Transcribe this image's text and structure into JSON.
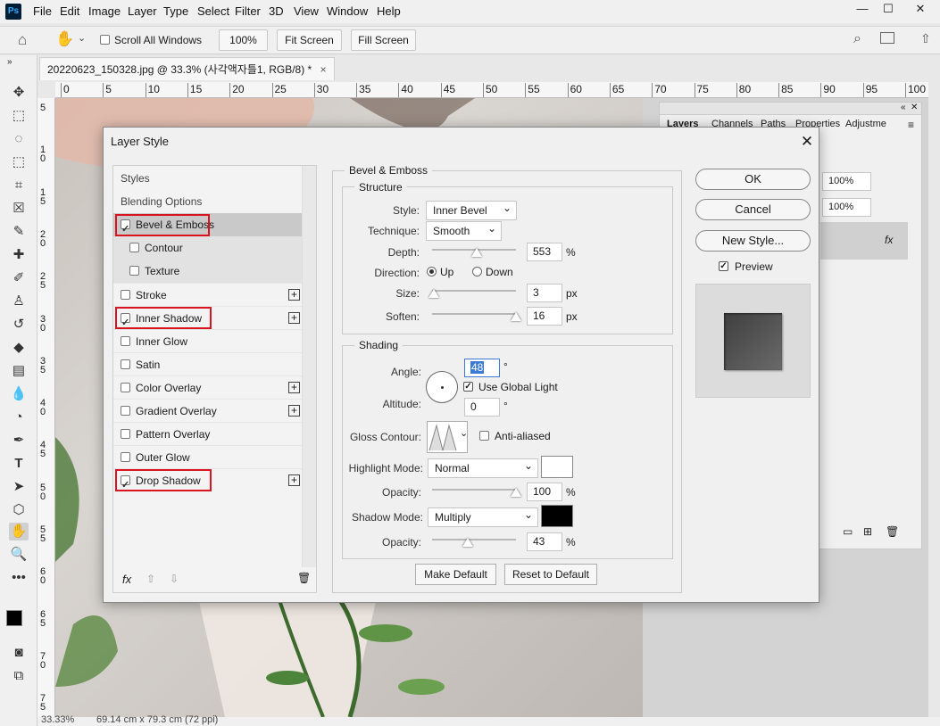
{
  "app": {
    "logo": "Ps"
  },
  "menu": [
    "File",
    "Edit",
    "Image",
    "Layer",
    "Type",
    "Select",
    "Filter",
    "3D",
    "View",
    "Window",
    "Help"
  ],
  "window_controls": {
    "minimize": "—",
    "maximize": "☐",
    "close": "✕"
  },
  "options_bar": {
    "scroll_all_windows": "Scroll All Windows",
    "zoom_btn": "100%",
    "fit_screen": "Fit Screen",
    "fill_screen": "Fill Screen"
  },
  "document_tab": {
    "title": "20220623_150328.jpg @ 33.3% (사각액자틀1, RGB/8) *",
    "close": "×"
  },
  "ruler": {
    "top": [
      "0",
      "5",
      "10",
      "15",
      "20",
      "25",
      "30",
      "35",
      "40",
      "45",
      "50",
      "55",
      "60",
      "65",
      "70",
      "75",
      "80",
      "85",
      "90",
      "95",
      "100"
    ],
    "left": [
      "5",
      "1\n0",
      "1\n5",
      "2\n0",
      "2\n5",
      "3\n0",
      "3\n5",
      "4\n0",
      "4\n5",
      "5\n0",
      "5\n5",
      "6\n0",
      "6\n5",
      "7\n0",
      "7\n5"
    ]
  },
  "status_bar": {
    "zoom": "33.33%",
    "doc_size": "69.14 cm x 79.3 cm (72 ppi)"
  },
  "layers_panel": {
    "tabs": [
      "Layers",
      "Channels",
      "Paths",
      "Properties",
      "Adjustme"
    ],
    "opacity": "100%",
    "fill": "100%",
    "fx": "fx"
  },
  "dialog": {
    "title": "Layer Style",
    "close": "✕",
    "styles_header": "Styles",
    "blending_options": "Blending Options",
    "items": [
      {
        "label": "Bevel & Emboss",
        "checked": true,
        "plus": false,
        "indent": false,
        "highlight": true
      },
      {
        "label": "Contour",
        "checked": false,
        "plus": false,
        "indent": true
      },
      {
        "label": "Texture",
        "checked": false,
        "plus": false,
        "indent": true
      },
      {
        "label": "Stroke",
        "checked": false,
        "plus": true
      },
      {
        "label": "Inner Shadow",
        "checked": true,
        "plus": true,
        "highlight": true
      },
      {
        "label": "Inner Glow",
        "checked": false,
        "plus": false
      },
      {
        "label": "Satin",
        "checked": false,
        "plus": false
      },
      {
        "label": "Color Overlay",
        "checked": false,
        "plus": true
      },
      {
        "label": "Gradient Overlay",
        "checked": false,
        "plus": true
      },
      {
        "label": "Pattern Overlay",
        "checked": false,
        "plus": false
      },
      {
        "label": "Outer Glow",
        "checked": false,
        "plus": false
      },
      {
        "label": "Drop Shadow",
        "checked": true,
        "plus": true,
        "highlight": true
      }
    ],
    "bottom_fx": "fx",
    "bevel": {
      "section": "Bevel & Emboss",
      "structure": "Structure",
      "style_label": "Style:",
      "style_value": "Inner Bevel",
      "technique_label": "Technique:",
      "technique_value": "Smooth",
      "depth_label": "Depth:",
      "depth_value": "553",
      "depth_unit": "%",
      "direction_label": "Direction:",
      "up": "Up",
      "down": "Down",
      "size_label": "Size:",
      "size_value": "3",
      "size_unit": "px",
      "soften_label": "Soften:",
      "soften_value": "16",
      "soften_unit": "px",
      "shading": "Shading",
      "angle_label": "Angle:",
      "angle_value": "48",
      "degree": "°",
      "use_global_light": "Use Global Light",
      "altitude_label": "Altitude:",
      "altitude_value": "0",
      "gloss_label": "Gloss Contour:",
      "anti_aliased": "Anti-aliased",
      "highlight_label": "Highlight Mode:",
      "highlight_value": "Normal",
      "opacity_label": "Opacity:",
      "highlight_opacity": "100",
      "pct": "%",
      "shadow_label": "Shadow Mode:",
      "shadow_value": "Multiply",
      "shadow_opacity": "43",
      "make_default": "Make Default",
      "reset_default": "Reset to Default"
    },
    "buttons": {
      "ok": "OK",
      "cancel": "Cancel",
      "new_style": "New Style...",
      "preview": "Preview"
    },
    "sliders": {
      "depth": 0.53,
      "size": 0.02,
      "soften": 1.0,
      "highlight_opacity": 1.0,
      "shadow_opacity": 0.43
    },
    "colors": {
      "highlight": "#ffffff",
      "shadow": "#000000",
      "accent": "#d9141e"
    }
  }
}
